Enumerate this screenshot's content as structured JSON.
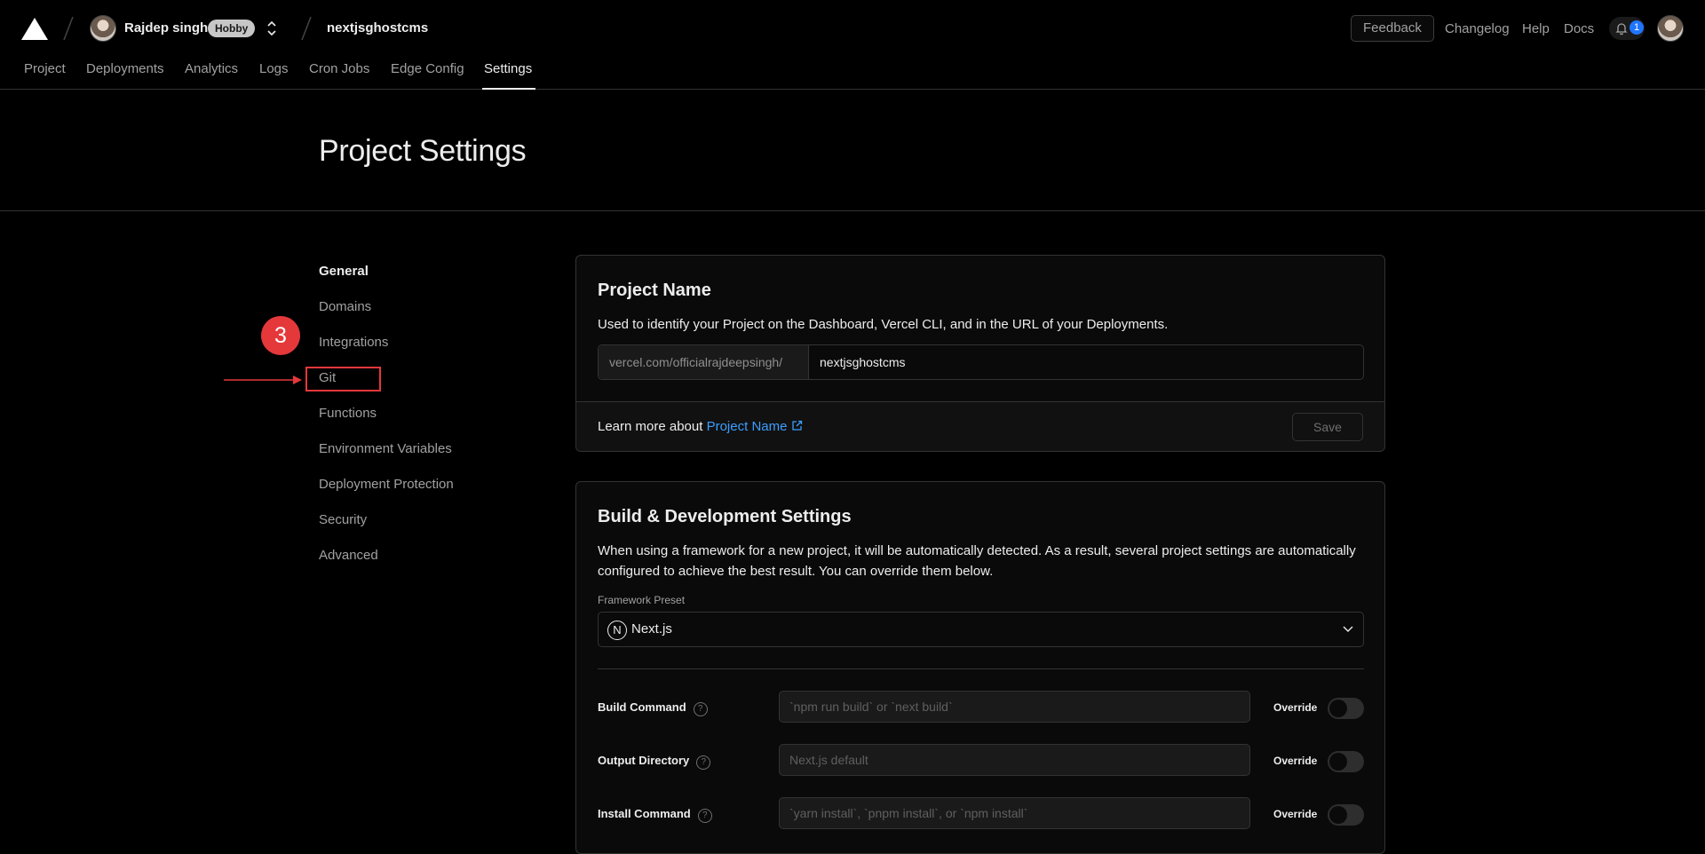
{
  "header": {
    "user_name": "Rajdep singh",
    "plan_badge": "Hobby",
    "project": "nextjsghostcms",
    "feedback_label": "Feedback",
    "links": [
      "Changelog",
      "Help",
      "Docs"
    ],
    "notification_count": "1"
  },
  "tabs": [
    "Project",
    "Deployments",
    "Analytics",
    "Logs",
    "Cron Jobs",
    "Edge Config",
    "Settings"
  ],
  "active_tab": "Settings",
  "page_title": "Project Settings",
  "sidebar": {
    "items": [
      "General",
      "Domains",
      "Integrations",
      "Git",
      "Functions",
      "Environment Variables",
      "Deployment Protection",
      "Security",
      "Advanced"
    ],
    "active": "General"
  },
  "annotation": {
    "step": "3",
    "highlighted_item": "Git",
    "color": "#e5383b"
  },
  "project_name_card": {
    "title": "Project Name",
    "description": "Used to identify your Project on the Dashboard, Vercel CLI, and in the URL of your Deployments.",
    "url_prefix": "vercel.com/officialrajdeepsingh/",
    "value": "nextjsghostcms",
    "learn_more_text": "Learn more about",
    "learn_more_link": "Project Name",
    "save_label": "Save"
  },
  "build_card": {
    "title": "Build & Development Settings",
    "description_line1": "When using a framework for a new project, it will be automatically detected. As a result, several project settings are automatically",
    "description_line2": "configured to achieve the best result. You can override them below.",
    "framework_label": "Framework Preset",
    "framework_value": "Next.js",
    "rows": [
      {
        "label": "Build Command",
        "placeholder": "`npm run build` or `next build`",
        "override_label": "Override"
      },
      {
        "label": "Output Directory",
        "placeholder": "Next.js default",
        "override_label": "Override"
      },
      {
        "label": "Install Command",
        "placeholder": "`yarn install`, `pnpm install`, or `npm install`",
        "override_label": "Override"
      }
    ]
  },
  "colors": {
    "background": "#000000",
    "accent_link": "#3b9eff",
    "notification": "#1f75ff"
  }
}
